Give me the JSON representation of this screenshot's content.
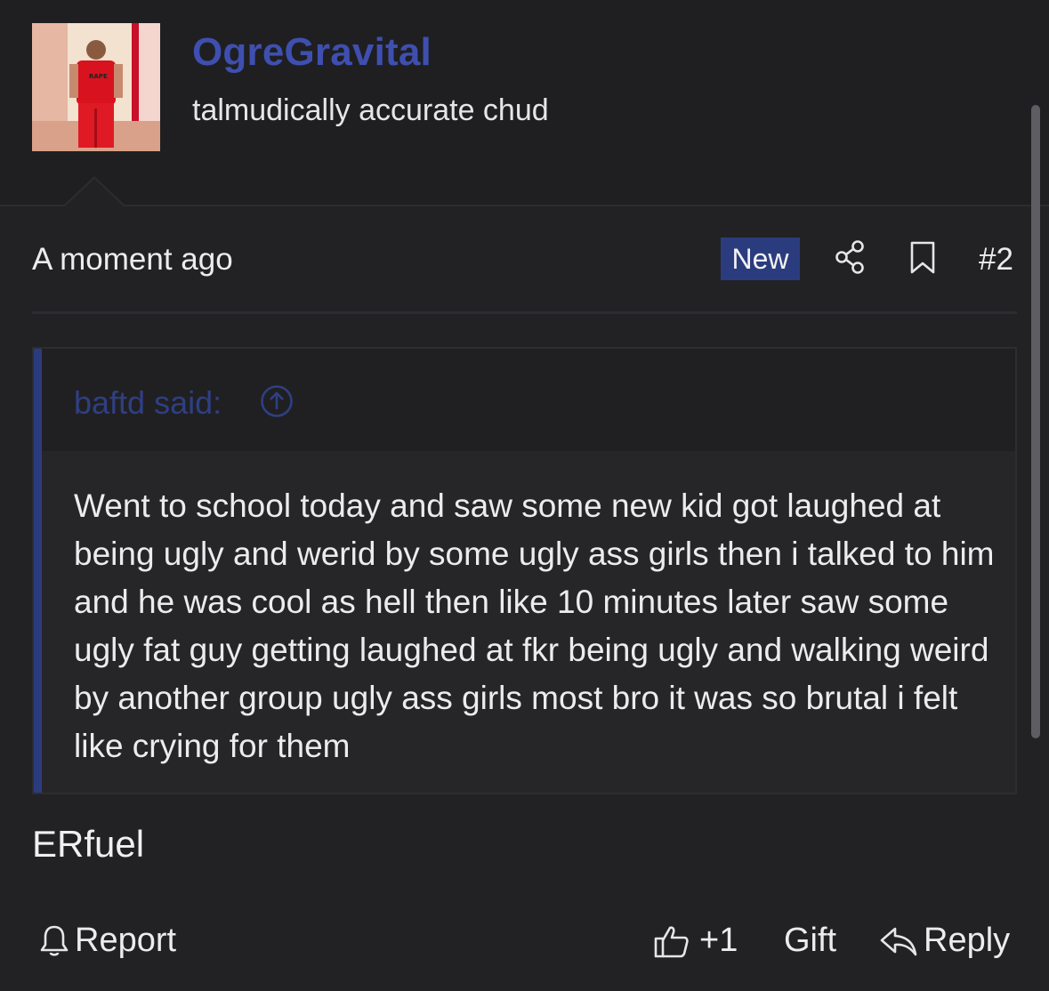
{
  "user": {
    "username": "OgreGravital",
    "title": "talmudically accurate chud",
    "avatar_shirt_text": "RAPE"
  },
  "post": {
    "timestamp": "A moment ago",
    "badge": "New",
    "number": "#2",
    "body": "ERfuel"
  },
  "quote": {
    "author": "baftd said:",
    "text": "Went to school today and saw some new kid got laughed at being ugly and werid by some ugly ass girls then i talked to him and he was cool as hell then like 10 minutes later saw some ugly fat guy getting laughed at fkr being ugly and walking weird by another group ugly ass girls most bro it was so brutal i felt like crying for them"
  },
  "actions": {
    "report": "Report",
    "like_count": "+1",
    "gift": "Gift",
    "reply": "Reply"
  },
  "colors": {
    "accent": "#3f4fb0",
    "badge_bg": "#2b3c7e",
    "background": "#222224"
  },
  "icons": [
    "share-icon",
    "bookmark-icon",
    "arrow-up-circle-icon",
    "bell-icon",
    "thumbs-up-icon",
    "reply-icon"
  ]
}
